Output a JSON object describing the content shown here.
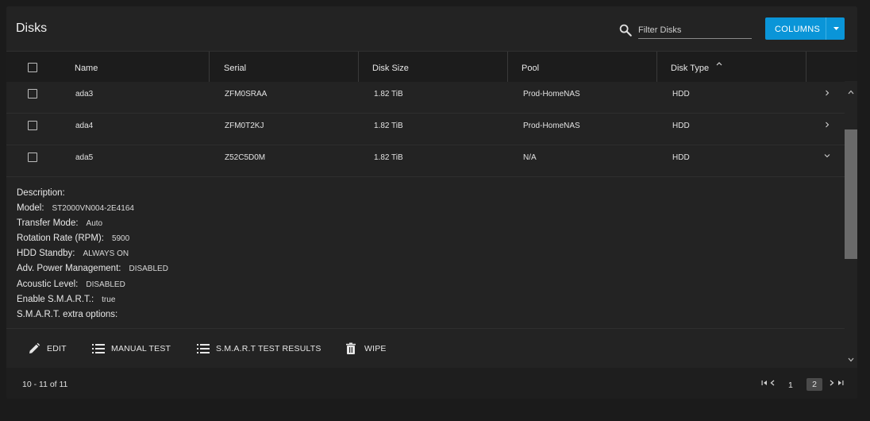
{
  "page": {
    "title": "Disks"
  },
  "toolbar": {
    "filter_placeholder": "Filter Disks",
    "columns_label": "COLUMNS"
  },
  "table": {
    "columns": [
      "Name",
      "Serial",
      "Disk Size",
      "Pool",
      "Disk Type"
    ],
    "sorted_column": "Disk Type",
    "sort_direction": "ascending",
    "rows": [
      {
        "name": "ada3",
        "serial": "ZFM0SRAA",
        "size": "1.82 TiB",
        "pool": "Prod-HomeNAS",
        "type": "HDD",
        "expanded": false
      },
      {
        "name": "ada4",
        "serial": "ZFM0T2KJ",
        "size": "1.82 TiB",
        "pool": "Prod-HomeNAS",
        "type": "HDD",
        "expanded": false
      },
      {
        "name": "ada5",
        "serial": "Z52C5D0M",
        "size": "1.82 TiB",
        "pool": "N/A",
        "type": "HDD",
        "expanded": true
      }
    ]
  },
  "details": {
    "description": {
      "label": "Description:",
      "value": ""
    },
    "model": {
      "label": "Model:",
      "value": "ST2000VN004-2E4164"
    },
    "transfer_mode": {
      "label": "Transfer Mode:",
      "value": "Auto"
    },
    "rotation_rate": {
      "label": "Rotation Rate (RPM):",
      "value": "5900"
    },
    "hdd_standby": {
      "label": "HDD Standby:",
      "value": "ALWAYS ON"
    },
    "apm": {
      "label": "Adv. Power Management:",
      "value": "DISABLED"
    },
    "acoustic": {
      "label": "Acoustic Level:",
      "value": "DISABLED"
    },
    "smart": {
      "label": "Enable S.M.A.R.T.:",
      "value": "true"
    },
    "smart_extra": {
      "label": "S.M.A.R.T. extra options:",
      "value": ""
    }
  },
  "actions": {
    "edit": "EDIT",
    "manual_test": "MANUAL TEST",
    "smart_results": "S.M.A.R.T TEST RESULTS",
    "wipe": "WIPE"
  },
  "pagination": {
    "range": "10 - 11 of 11",
    "pages": [
      "1",
      "2"
    ],
    "current_page": "2"
  },
  "colors": {
    "accent": "#0a95d8",
    "background": "#1b1b1b",
    "card": "#232323"
  },
  "icons": [
    "search-icon",
    "chevron-down-icon",
    "chevron-right-icon",
    "pencil-icon",
    "list-icon",
    "delete-icon",
    "first-page-icon",
    "previous-page-icon",
    "next-page-icon",
    "last-page-icon",
    "sort-ascending-icon"
  ]
}
